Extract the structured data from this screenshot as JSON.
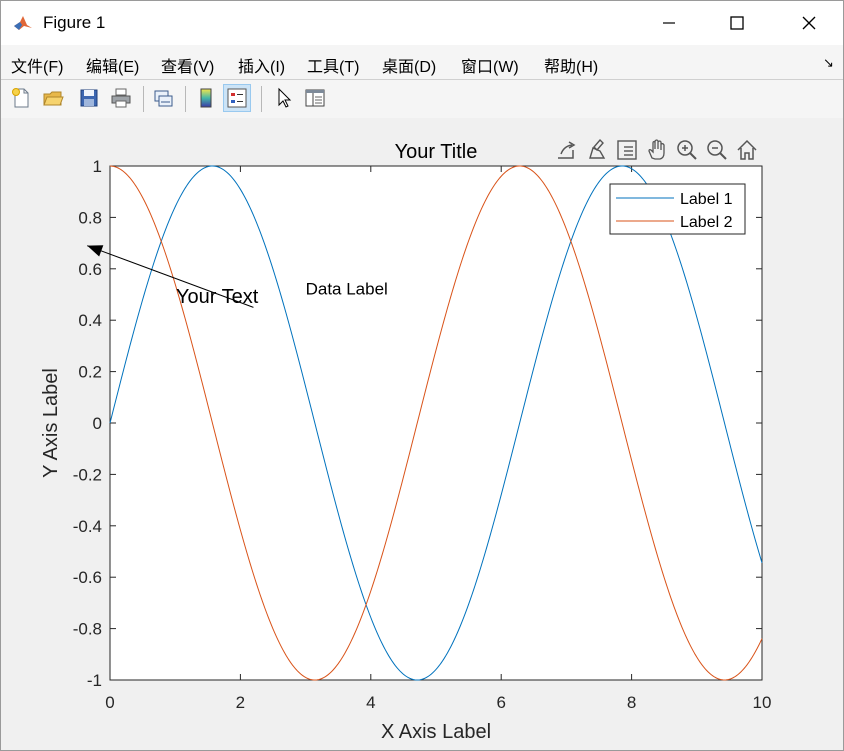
{
  "window": {
    "title": "Figure 1",
    "minimize_glyph": "—",
    "maximize_glyph": "☐",
    "close_glyph": "✕"
  },
  "menu": {
    "items": [
      "文件(F)",
      "编辑(E)",
      "查看(V)",
      "插入(I)",
      "工具(T)",
      "桌面(D)",
      "窗口(W)",
      "帮助(H)"
    ],
    "dock_glyph": "↘"
  },
  "toolbar": {
    "buttons": [
      "new-figure-icon",
      "open-file-icon",
      "save-icon",
      "print-icon",
      "link-plot-icon",
      "colorbar-icon",
      "legend-icon",
      "edit-plot-icon",
      "property-inspector-icon"
    ]
  },
  "axes_toolbar": {
    "buttons": [
      "export-icon",
      "brush-icon",
      "data-tips-icon",
      "pan-icon",
      "zoom-in-icon",
      "zoom-out-icon",
      "home-icon"
    ]
  },
  "chart_data": {
    "type": "line",
    "title": "Your Title",
    "xlabel": "X Axis Label",
    "ylabel": "Y Axis Label",
    "xlim": [
      0,
      10
    ],
    "ylim": [
      -1,
      1
    ],
    "xticks": [
      "0",
      "2",
      "4",
      "6",
      "8",
      "10"
    ],
    "yticks": [
      "-1",
      "-0.8",
      "-0.6",
      "-0.4",
      "-0.2",
      "0",
      "0.2",
      "0.4",
      "0.6",
      "0.8",
      "1"
    ],
    "series": [
      {
        "name": "Label 1",
        "function": "sin(x)",
        "color": "#0072BD"
      },
      {
        "name": "Label 2",
        "function": "cos(x)",
        "color": "#D95319"
      }
    ],
    "legend_position": "top-right",
    "annotations": {
      "arrow_text": "Your Text",
      "arrow_from": [
        2.2,
        0.45
      ],
      "arrow_to": [
        -0.35,
        0.69
      ],
      "text_label": "Data Label",
      "text_label_at": [
        3.0,
        0.5
      ]
    },
    "grid": false
  }
}
